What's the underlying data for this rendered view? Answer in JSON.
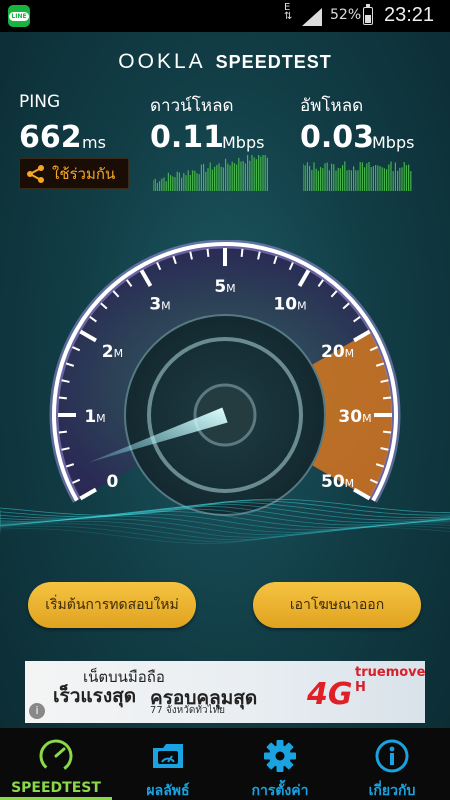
{
  "status_bar": {
    "app_icon": "line-icon",
    "app_icon_text": "LINE",
    "network_type": "E",
    "battery_percent": "52%",
    "time": "23:21"
  },
  "header": {
    "brand": "OOKLA",
    "product": "SPEEDTEST"
  },
  "stats": {
    "ping": {
      "label": "PING",
      "value": "662",
      "unit": "ms"
    },
    "download": {
      "label": "ดาวน์โหลด",
      "value": "0.11",
      "unit": "Mbps"
    },
    "upload": {
      "label": "อัพโหลด",
      "value": "0.03",
      "unit": "Mbps"
    },
    "share_label": "ใช้ร่วมกัน"
  },
  "gauge": {
    "ticks": [
      {
        "num": "0",
        "suffix": ""
      },
      {
        "num": "1",
        "suffix": "M"
      },
      {
        "num": "2",
        "suffix": "M"
      },
      {
        "num": "3",
        "suffix": "M"
      },
      {
        "num": "5",
        "suffix": "M"
      },
      {
        "num": "10",
        "suffix": "M"
      },
      {
        "num": "20",
        "suffix": "M"
      },
      {
        "num": "30",
        "suffix": "M"
      },
      {
        "num": "50",
        "suffix": "M"
      }
    ],
    "current_mbps": 0.11
  },
  "actions": {
    "restart_label": "เริ่มต้นการทดสอบใหม่",
    "remove_ads_label": "เอาโฆษณาออก"
  },
  "ad": {
    "line1": "เน็ตบนมือถือ",
    "line2": "เร็วแรงสุด",
    "line3": "ครอบคลุมสุด",
    "line4": "77 จังหวัดทั่วไทย",
    "brand": "truemove H",
    "badge": "4G",
    "info_icon": "info-icon"
  },
  "bottom_nav": {
    "items": [
      {
        "label": "SPEEDTEST",
        "icon": "gauge-icon"
      },
      {
        "label": "ผลลัพธ์",
        "icon": "results-icon"
      },
      {
        "label": "การตั้งค่า",
        "icon": "gear-icon"
      },
      {
        "label": "เกี่ยวกับ",
        "icon": "info-icon"
      }
    ]
  },
  "colors": {
    "accent_orange": "#f7a722",
    "nav_active": "#8bd84a",
    "nav_inactive": "#1aa3e0",
    "gauge_fill": "#d4781e"
  }
}
